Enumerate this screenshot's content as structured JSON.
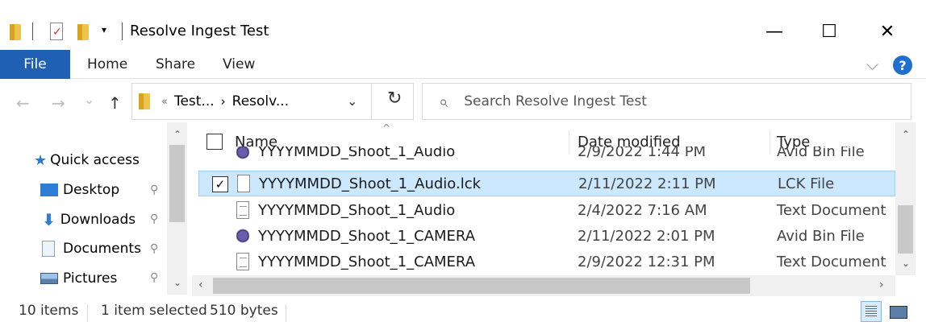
{
  "window": {
    "title": "Resolve Ingest Test",
    "quick_access_dropdown": "▾",
    "minimize": "—",
    "maximize": "☐",
    "close": "✕"
  },
  "ribbon": {
    "tabs": [
      "File",
      "Home",
      "Share",
      "View"
    ],
    "expand_icon": "chevron-down-icon",
    "help": "?"
  },
  "nav": {
    "back": "←",
    "forward": "→",
    "recent": "⌄",
    "up": "↑"
  },
  "address": {
    "prefix": "«",
    "crumbs": [
      "Test...",
      "Resolv..."
    ],
    "separator": "›",
    "dropdown": "⌄",
    "refresh": "↻"
  },
  "search": {
    "placeholder": "Search Resolve Ingest Test"
  },
  "sidebar": {
    "items": [
      {
        "label": "Quick access",
        "icon": "star-icon"
      },
      {
        "label": "Desktop",
        "icon": "desktop-icon",
        "pinned": true
      },
      {
        "label": "Downloads",
        "icon": "download-icon",
        "pinned": true
      },
      {
        "label": "Documents",
        "icon": "documents-icon",
        "pinned": true
      },
      {
        "label": "Pictures",
        "icon": "pictures-icon",
        "pinned": true
      }
    ],
    "pin_glyph": "📌"
  },
  "files": {
    "columns": [
      "Name",
      "Date modified",
      "Type"
    ],
    "rows": [
      {
        "name": "YYYYMMDD_Shoot_1_Audio",
        "date": "2/9/2022 1:44 PM",
        "type": "Avid Bin File",
        "icon": "avid-bin-icon",
        "selected": false,
        "partial": true
      },
      {
        "name": "YYYYMMDD_Shoot_1_Audio.lck",
        "date": "2/11/2022 2:11 PM",
        "type": "LCK File",
        "icon": "blank-file-icon",
        "selected": true
      },
      {
        "name": "YYYYMMDD_Shoot_1_Audio",
        "date": "2/4/2022 7:16 AM",
        "type": "Text Document",
        "icon": "text-file-icon",
        "selected": false
      },
      {
        "name": "YYYYMMDD_Shoot_1_CAMERA",
        "date": "2/11/2022 2:01 PM",
        "type": "Avid Bin File",
        "icon": "avid-bin-icon",
        "selected": false
      },
      {
        "name": "YYYYMMDD_Shoot_1_CAMERA",
        "date": "2/9/2022 12:31 PM",
        "type": "Text Document",
        "icon": "text-file-icon",
        "selected": false
      }
    ]
  },
  "status": {
    "item_count": "10 items",
    "selected": "1 item selected",
    "size": "510 bytes"
  },
  "colors": {
    "accent": "#1f5fb4",
    "selection": "#cce8ff",
    "selection_border": "#99d1ff"
  }
}
